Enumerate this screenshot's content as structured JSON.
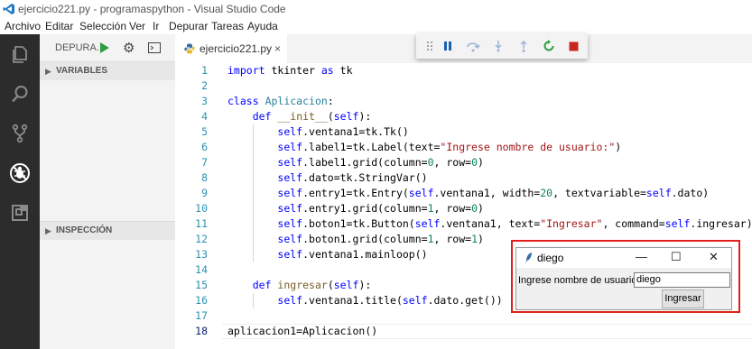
{
  "window": {
    "title": "ejercicio221.py - programaspython - Visual Studio Code"
  },
  "menu": [
    "Archivo",
    "Editar",
    "Selección",
    "Ver",
    "Ir",
    "Depurar",
    "Tareas",
    "Ayuda"
  ],
  "activity_bar": {
    "icons": [
      "explorer-icon",
      "search-icon",
      "source-control-icon",
      "debug-icon",
      "extensions-icon"
    ],
    "active": "debug-icon"
  },
  "sidebar": {
    "debug_label": "DEPURA...",
    "sections": [
      {
        "label": "VARIABLES",
        "expanded": false
      },
      {
        "label": "INSPECCIÓN",
        "expanded": false
      }
    ]
  },
  "tab": {
    "filename": "ejercicio221.py",
    "close": "×"
  },
  "debug_toolbar": {
    "buttons": [
      "drag-handle",
      "pause",
      "step-over",
      "step-into",
      "step-out",
      "restart",
      "stop"
    ]
  },
  "editor": {
    "current_line": 18,
    "lines": [
      "import tkinter as tk",
      "",
      "class Aplicacion:",
      "    def __init__(self):",
      "        self.ventana1=tk.Tk()",
      "        self.label1=tk.Label(text=\"Ingrese nombre de usuario:\")",
      "        self.label1.grid(column=0, row=0)",
      "        self.dato=tk.StringVar()",
      "        self.entry1=tk.Entry(self.ventana1, width=20, textvariable=self.dato)",
      "        self.entry1.grid(column=1, row=0)",
      "        self.boton1=tk.Button(self.ventana1, text=\"Ingresar\", command=self.ingresar)",
      "        self.boton1.grid(column=1, row=1)",
      "        self.ventana1.mainloop()",
      "",
      "    def ingresar(self):",
      "        self.ventana1.title(self.dato.get())",
      "",
      "aplicacion1=Aplicacion()"
    ]
  },
  "tk_window": {
    "title": "diego",
    "minimize": "—",
    "maximize": "☐",
    "close": "✕",
    "label": "Ingrese nombre de usuario:",
    "entry_value": "diego",
    "button": "Ingresar"
  },
  "colors": {
    "activity_bar": "#2c2c2c",
    "highlight_border": "#e0201a",
    "play_green": "#2f9e3f",
    "stop_red": "#c5281c",
    "debug_blue": "#1a5fb4"
  }
}
